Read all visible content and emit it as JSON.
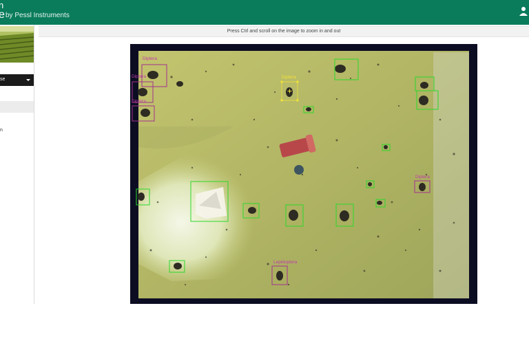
{
  "header": {
    "brand_mark_top": "n",
    "brand_mark_bottom": "e",
    "brand_sub": "by Pessl Instruments",
    "user_icon": "user-icon",
    "colors": {
      "bar": "#0a7c5b"
    }
  },
  "sidebar": {
    "station_select_value": "se",
    "menu_item_label": "n"
  },
  "main": {
    "hint": "Press Ctrl and scroll on the image to zoom in and out"
  },
  "trap_image": {
    "colors": {
      "insect_box": "#2bd82b",
      "class_box": "#a2328f",
      "selected_box": "#f2e23a"
    },
    "labels": {
      "d1": "Diptera",
      "d2": "Diptera",
      "d3": "Diptera",
      "d4": "Diptera",
      "d5": "Diptera",
      "l1": "Lepidoptera"
    }
  }
}
